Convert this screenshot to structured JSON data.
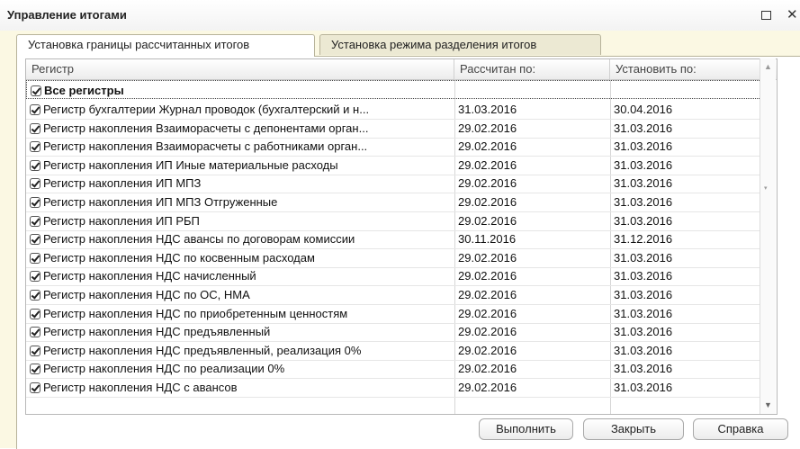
{
  "window": {
    "title": "Управление итогами"
  },
  "tabs": [
    {
      "label": "Установка границы рассчитанных итогов",
      "active": true
    },
    {
      "label": "Установка режима разделения итогов",
      "active": false
    }
  ],
  "table": {
    "columns": [
      "Регистр",
      "Рассчитан по:",
      "Установить по:"
    ],
    "all_row": {
      "label": "Все регистры",
      "checked": true
    },
    "rows": [
      {
        "name": "Регистр бухгалтерии Журнал проводок (бухгалтерский и н...",
        "calc": "31.03.2016",
        "set": "30.04.2016",
        "checked": true
      },
      {
        "name": "Регистр накопления Взаиморасчеты с депонентами орган...",
        "calc": "29.02.2016",
        "set": "31.03.2016",
        "checked": true
      },
      {
        "name": "Регистр накопления Взаиморасчеты с работниками орган...",
        "calc": "29.02.2016",
        "set": "31.03.2016",
        "checked": true
      },
      {
        "name": "Регистр накопления ИП Иные материальные расходы",
        "calc": "29.02.2016",
        "set": "31.03.2016",
        "checked": true
      },
      {
        "name": "Регистр накопления ИП МПЗ",
        "calc": "29.02.2016",
        "set": "31.03.2016",
        "checked": true
      },
      {
        "name": "Регистр накопления ИП МПЗ Отгруженные",
        "calc": "29.02.2016",
        "set": "31.03.2016",
        "checked": true
      },
      {
        "name": "Регистр накопления ИП РБП",
        "calc": "29.02.2016",
        "set": "31.03.2016",
        "checked": true
      },
      {
        "name": "Регистр накопления НДС авансы по договорам комиссии",
        "calc": "30.11.2016",
        "set": "31.12.2016",
        "checked": true
      },
      {
        "name": "Регистр накопления НДС по косвенным расходам",
        "calc": "29.02.2016",
        "set": "31.03.2016",
        "checked": true
      },
      {
        "name": "Регистр накопления НДС начисленный",
        "calc": "29.02.2016",
        "set": "31.03.2016",
        "checked": true
      },
      {
        "name": "Регистр накопления НДС по ОС, НМА",
        "calc": "29.02.2016",
        "set": "31.03.2016",
        "checked": true
      },
      {
        "name": "Регистр накопления НДС по приобретенным ценностям",
        "calc": "29.02.2016",
        "set": "31.03.2016",
        "checked": true
      },
      {
        "name": "Регистр накопления НДС предъявленный",
        "calc": "29.02.2016",
        "set": "31.03.2016",
        "checked": true
      },
      {
        "name": "Регистр накопления НДС предъявленный, реализация 0%",
        "calc": "29.02.2016",
        "set": "31.03.2016",
        "checked": true
      },
      {
        "name": "Регистр накопления НДС по реализации 0%",
        "calc": "29.02.2016",
        "set": "31.03.2016",
        "checked": true
      },
      {
        "name": "Регистр накопления НДС с авансов",
        "calc": "29.02.2016",
        "set": "31.03.2016",
        "checked": true
      }
    ]
  },
  "buttons": {
    "run": "Выполнить",
    "close": "Закрыть",
    "help": "Справка"
  },
  "icons": {
    "maximize": "maximize-icon",
    "close": "close-icon",
    "check": "checkbox-checked-icon"
  }
}
